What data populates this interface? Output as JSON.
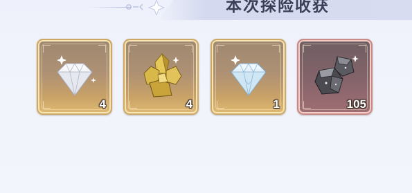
{
  "header": {
    "title": "本次探险收获"
  },
  "rewards": [
    {
      "icon": "white-diamond-icon",
      "count": "4",
      "rarity": "gold"
    },
    {
      "icon": "gold-ore-crystal-icon",
      "count": "4",
      "rarity": "gold"
    },
    {
      "icon": "blue-diamond-icon",
      "count": "1",
      "rarity": "gold"
    },
    {
      "icon": "iron-ore-icon",
      "count": "105",
      "rarity": "red"
    }
  ],
  "colors": {
    "gold_border": "#cfa864",
    "red_border": "#c98a86",
    "title": "#3a3f57",
    "background": "#eef1fb"
  }
}
